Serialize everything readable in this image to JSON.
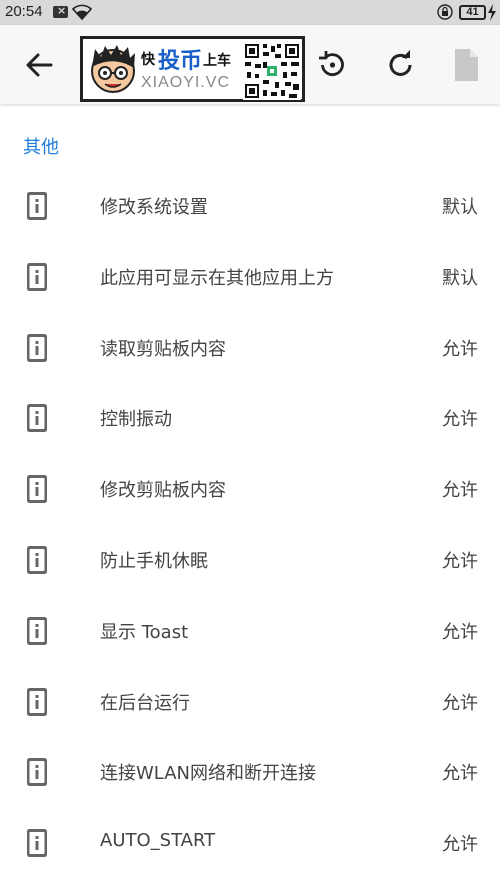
{
  "status_bar": {
    "time": "20:54",
    "notification_icon": "notification-x-icon",
    "battery": "41"
  },
  "toolbar": {
    "banner": {
      "fast": "快",
      "coin": "投币",
      "car": "上车",
      "site": "XIAOYI.VC"
    },
    "icons": [
      "back-arrow-icon",
      "restore-icon",
      "refresh-icon",
      "file-icon"
    ]
  },
  "section": {
    "title": "其他"
  },
  "permissions": [
    {
      "label": "修改系统设置",
      "value": "默认"
    },
    {
      "label": "此应用可显示在其他应用上方",
      "value": "默认"
    },
    {
      "label": "读取剪贴板内容",
      "value": "允许"
    },
    {
      "label": "控制振动",
      "value": "允许"
    },
    {
      "label": "修改剪贴板内容",
      "value": "允许"
    },
    {
      "label": "防止手机休眠",
      "value": "允许"
    },
    {
      "label": "显示 Toast",
      "value": "允许"
    },
    {
      "label": "在后台运行",
      "value": "允许"
    },
    {
      "label": "连接WLAN网络和断开连接",
      "value": "允许"
    },
    {
      "label": "AUTO_START",
      "value": "允许"
    }
  ],
  "colors": {
    "accent": "#1e7ed8",
    "status_bar_bg": "#d9d9d9",
    "toolbar_bg": "#f7f7f7",
    "icon_gray": "#666666"
  }
}
